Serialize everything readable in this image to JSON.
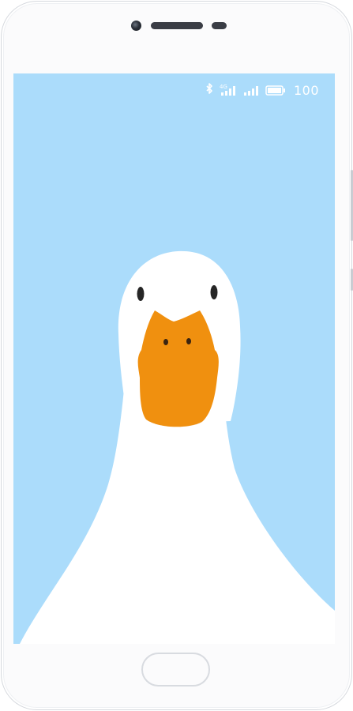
{
  "device": {
    "frame_color": "#fbfbfc",
    "screen_background": "#abdcfb"
  },
  "status_bar": {
    "icons": [
      "bluetooth-icon",
      "signal-4g-icon",
      "signal-icon",
      "battery-icon"
    ],
    "network_label": "4G",
    "battery_level": "100",
    "icon_color": "#ffffff"
  },
  "wallpaper": {
    "subject": "duck-illustration",
    "beak_color": "#f0900f",
    "body_color": "#ffffff"
  }
}
